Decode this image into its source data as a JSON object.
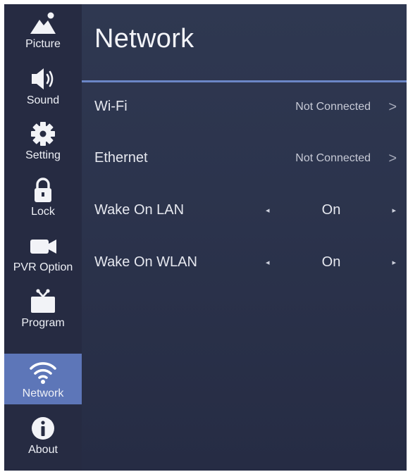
{
  "sidebar": {
    "items": [
      {
        "label": "Picture",
        "icon": "picture-icon",
        "active": false
      },
      {
        "label": "Sound",
        "icon": "speaker-icon",
        "active": false
      },
      {
        "label": "Setting",
        "icon": "gear-icon",
        "active": false
      },
      {
        "label": "Lock",
        "icon": "lock-icon",
        "active": false
      },
      {
        "label": "PVR Option",
        "icon": "video-camera-icon",
        "active": false
      },
      {
        "label": "Program",
        "icon": "tv-icon",
        "active": false
      },
      {
        "label": "Network",
        "icon": "wifi-icon",
        "active": true
      },
      {
        "label": "About",
        "icon": "info-icon",
        "active": false
      }
    ]
  },
  "main": {
    "title": "Network",
    "rows": [
      {
        "name": "Wi-Fi",
        "status": "Not Connected",
        "chevron": ">"
      },
      {
        "name": "Ethernet",
        "status": "Not Connected",
        "chevron": ">"
      },
      {
        "name": "Wake On LAN",
        "value": "On",
        "left_arrow": "◂",
        "right_arrow": "▸"
      },
      {
        "name": "Wake On WLAN",
        "value": "On",
        "left_arrow": "◂",
        "right_arrow": "▸"
      }
    ]
  },
  "colors": {
    "background": "#2c344d",
    "sidebar": "#262b42",
    "active_item": "#5d76b8",
    "divider": "#6b86c6",
    "text": "#e6e8ef"
  }
}
